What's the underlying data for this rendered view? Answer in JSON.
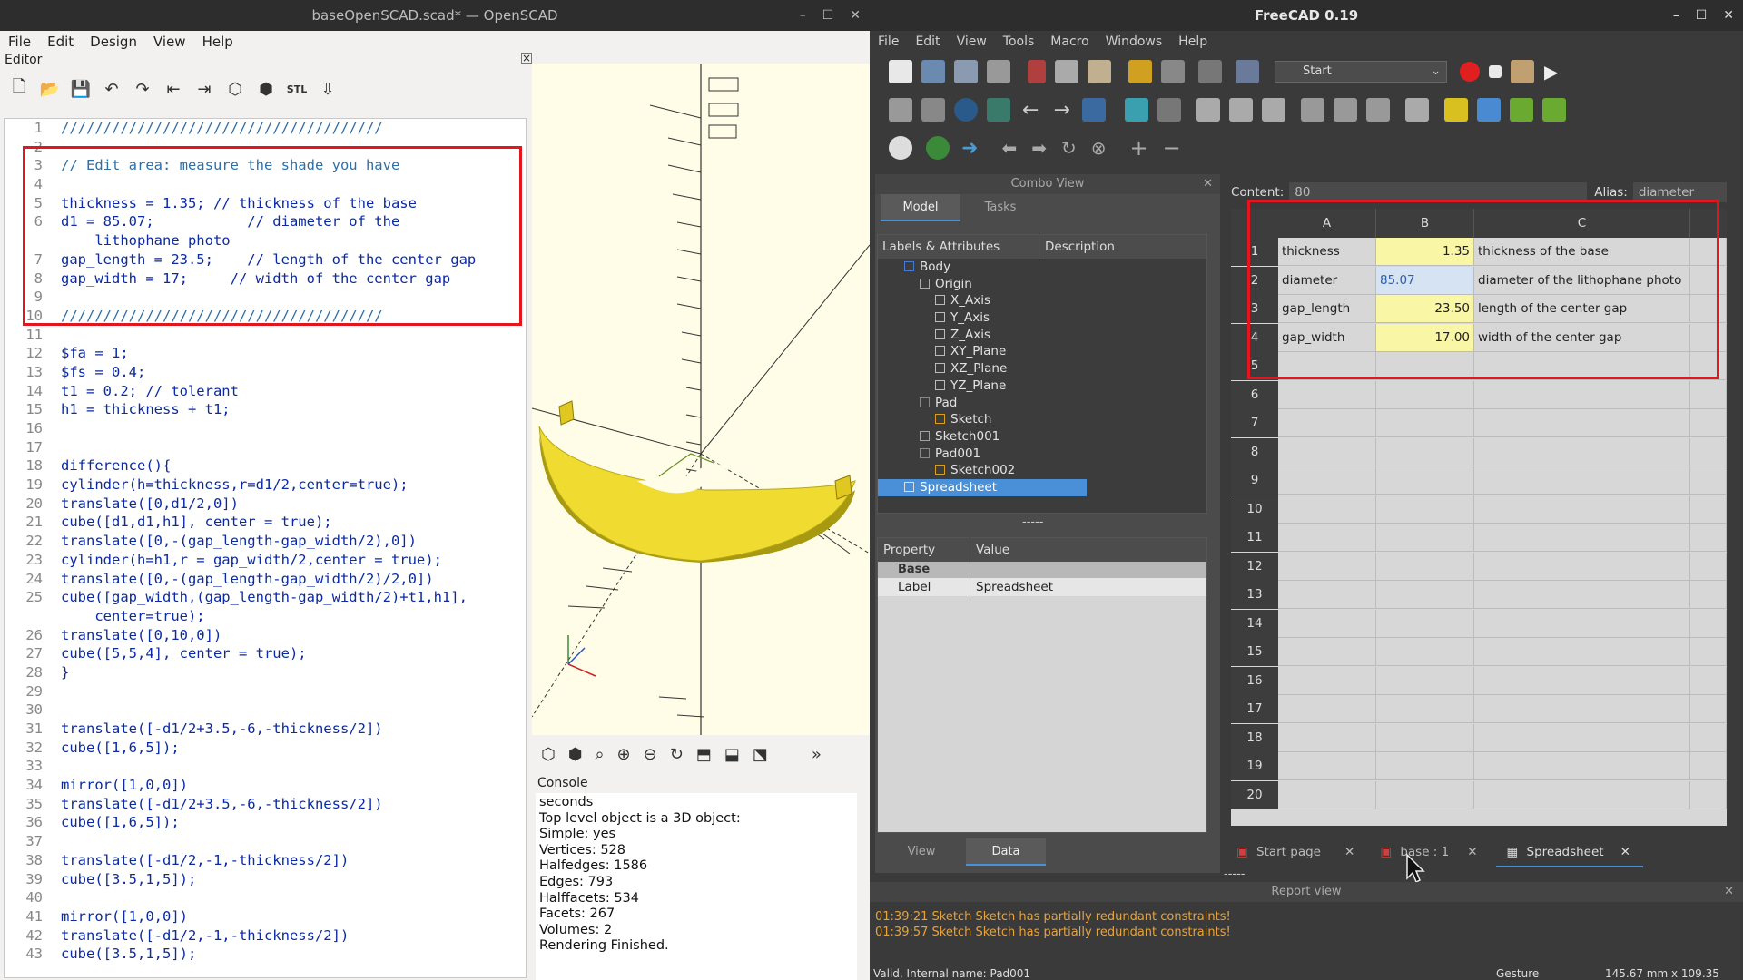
{
  "openscad": {
    "title": "baseOpenSCAD.scad* — OpenSCAD",
    "menu": [
      "File",
      "Edit",
      "Design",
      "View",
      "Help"
    ],
    "editor_label": "Editor",
    "line_numbers": [
      "1",
      "2",
      "3",
      "4",
      "5",
      "6",
      "",
      "7",
      "8",
      "9",
      "10",
      "11",
      "12",
      "13",
      "14",
      "15",
      "16",
      "17",
      "18",
      "19",
      "20",
      "21",
      "22",
      "23",
      "24",
      "25",
      "",
      "26",
      "27",
      "28",
      "29",
      "30",
      "31",
      "32",
      "33",
      "34",
      "35",
      "36",
      "37",
      "38",
      "39",
      "40",
      "41",
      "42",
      "43"
    ],
    "code": [
      "//////////////////////////////////////",
      "",
      "// Edit area: measure the shade you have",
      "",
      "thickness = 1.35; // thickness of the base",
      "d1 = 85.07;           // diameter of the",
      "    lithophane photo",
      "gap_length = 23.5;    // length of the center gap",
      "gap_width = 17;     // width of the center gap",
      "",
      "//////////////////////////////////////",
      "",
      "$fa = 1;",
      "$fs = 0.4;",
      "t1 = 0.2; // tolerant",
      "h1 = thickness + t1;",
      "",
      "",
      "difference(){",
      "cylinder(h=thickness,r=d1/2,center=true);",
      "translate([0,d1/2,0])",
      "cube([d1,d1,h1], center = true);",
      "translate([0,-(gap_length-gap_width/2),0])",
      "cylinder(h=h1,r = gap_width/2,center = true);",
      "translate([0,-(gap_length-gap_width/2)/2,0])",
      "cube([gap_width,(gap_length-gap_width/2)+t1,h1],",
      "    center=true);",
      "translate([0,10,0])",
      "cube([5,5,4], center = true);",
      "}",
      "",
      "",
      "translate([-d1/2+3.5,-6,-thickness/2])",
      "cube([1,6,5]);",
      "",
      "mirror([1,0,0])",
      "translate([-d1/2+3.5,-6,-thickness/2])",
      "cube([1,6,5]);",
      "",
      "translate([-d1/2,-1,-thickness/2])",
      "cube([3.5,1,5]);",
      "",
      "mirror([1,0,0])",
      "translate([-d1/2,-1,-thickness/2])",
      "cube([3.5,1,5]);"
    ],
    "console_label": "Console",
    "console_lines": [
      "seconds",
      "Top level object is a 3D object:",
      "Simple: yes",
      "Vertices: 528",
      "Halfedges: 1586",
      "Edges: 793",
      "Halffacets: 534",
      "Facets: 267",
      "Volumes: 2",
      "Rendering Finished."
    ],
    "colors": {
      "model": "#f0dc30",
      "highlight_box": "#e3161d",
      "code": "#0b2aa3",
      "comment": "#2e6fa8"
    }
  },
  "freecad": {
    "title": "FreeCAD 0.19",
    "menu": [
      "File",
      "Edit",
      "View",
      "Tools",
      "Macro",
      "Windows",
      "Help"
    ],
    "workbench": "Start",
    "combo_view": "Combo View",
    "tabs": [
      "Model",
      "Tasks"
    ],
    "tree_headers": [
      "Labels & Attributes",
      "Description"
    ],
    "tree": [
      {
        "label": "Body",
        "indent": 1,
        "icon": "body-icon"
      },
      {
        "label": "Origin",
        "indent": 2,
        "icon": "origin-icon"
      },
      {
        "label": "X_Axis",
        "indent": 3,
        "icon": "axis-icon"
      },
      {
        "label": "Y_Axis",
        "indent": 3,
        "icon": "axis-icon"
      },
      {
        "label": "Z_Axis",
        "indent": 3,
        "icon": "axis-icon"
      },
      {
        "label": "XY_Plane",
        "indent": 3,
        "icon": "plane-icon"
      },
      {
        "label": "XZ_Plane",
        "indent": 3,
        "icon": "plane-icon"
      },
      {
        "label": "YZ_Plane",
        "indent": 3,
        "icon": "plane-icon"
      },
      {
        "label": "Pad",
        "indent": 2,
        "icon": "pad-icon"
      },
      {
        "label": "Sketch",
        "indent": 3,
        "icon": "sketch-icon"
      },
      {
        "label": "Sketch001",
        "indent": 2,
        "icon": "sketch-icon"
      },
      {
        "label": "Pad001",
        "indent": 2,
        "icon": "pad-icon"
      },
      {
        "label": "Sketch002",
        "indent": 3,
        "icon": "sketch-icon"
      },
      {
        "label": "Spreadsheet",
        "indent": 1,
        "icon": "spreadsheet-icon",
        "selected": true
      }
    ],
    "splitter": "-----",
    "property_headers": [
      "Property",
      "Value"
    ],
    "property_group": "Base",
    "property_rows": [
      {
        "name": "Label",
        "value": "Spreadsheet"
      }
    ],
    "view_tabs": [
      "View",
      "Data"
    ],
    "content_label": "Content:",
    "content_value": "80",
    "alias_label": "Alias:",
    "alias_value": "diameter",
    "columns": [
      "A",
      "B",
      "C"
    ],
    "rows": [
      "1",
      "2",
      "3",
      "4",
      "5",
      "6",
      "7",
      "8",
      "9",
      "10",
      "11",
      "12",
      "13",
      "14",
      "15",
      "16",
      "17",
      "18",
      "19",
      "20"
    ],
    "cells": [
      [
        "thickness",
        "1.35",
        "thickness of the base"
      ],
      [
        "diameter",
        "85.07",
        "diameter of the lithophane photo"
      ],
      [
        "gap_length",
        "23.50",
        "length of the center gap"
      ],
      [
        "gap_width",
        "17.00",
        "width of the center gap"
      ]
    ],
    "doc_tabs": [
      "Start page",
      "base : 1",
      "Spreadsheet"
    ],
    "report_label": "Report view",
    "report_lines": [
      "01:39:21  Sketch Sketch has partially redundant constraints!",
      "01:39:57  Sketch Sketch has partially redundant constraints!"
    ],
    "status_left": "Valid, Internal name: Pad001",
    "status_nav": "Gesture",
    "status_dims": "145.67 mm x 109.35 mm",
    "colors": {
      "selection": "#4a90d9",
      "cell_yellow": "#f9f7a6",
      "record": "#e02020",
      "warning": "#e8a33a"
    }
  }
}
